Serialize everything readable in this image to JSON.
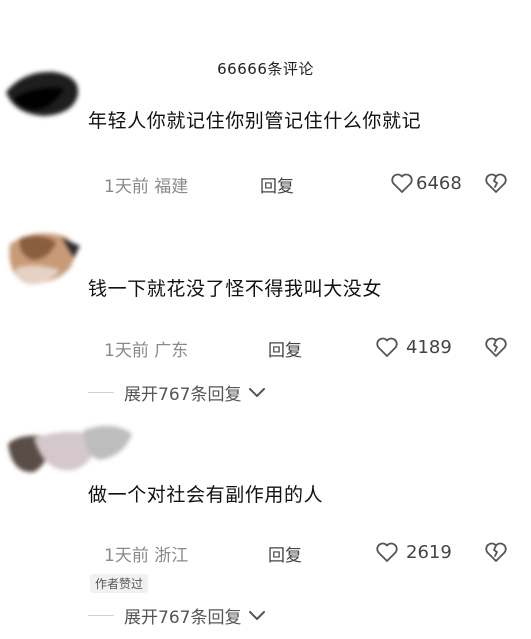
{
  "header": {
    "title": "66666条评论"
  },
  "comments": [
    {
      "text": "年轻人你就记住你别管记住什么你就记",
      "time_location": "1天前 福建",
      "reply_label": "回复",
      "likes": "6468"
    },
    {
      "text": "钱一下就花没了怪不得我叫大没女",
      "time_location": "1天前 广东",
      "reply_label": "回复",
      "likes": "4189",
      "expand_label": "展开767条回复"
    },
    {
      "text": "做一个对社会有副作用的人",
      "time_location": "1天前 浙江",
      "reply_label": "回复",
      "likes": "2619",
      "author_badge": "作者赞过",
      "expand_label": "展开767条回复"
    }
  ]
}
